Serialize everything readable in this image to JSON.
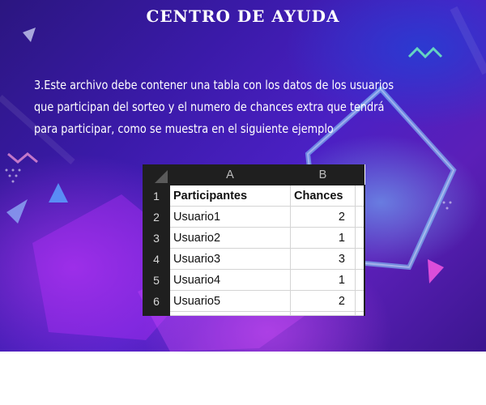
{
  "header": {
    "title": "CENTRO DE AYUDA"
  },
  "instructions": {
    "lines": [
      "3.Este archivo debe contener una tabla con los datos de los usuarios",
      " que participan del sorteo y el numero de chances extra que tendrá",
      "para participar, como se muestra en el siguiente ejemplo"
    ]
  },
  "spreadsheet": {
    "columns": [
      "A",
      "B"
    ],
    "rows": [
      {
        "num": "1",
        "a": "Participantes",
        "b": "Chances"
      },
      {
        "num": "2",
        "a": "Usuario1",
        "b": "2"
      },
      {
        "num": "3",
        "a": "Usuario2",
        "b": "1"
      },
      {
        "num": "4",
        "a": "Usuario3",
        "b": "3"
      },
      {
        "num": "5",
        "a": "Usuario4",
        "b": "1"
      },
      {
        "num": "6",
        "a": "Usuario5",
        "b": "2"
      }
    ]
  },
  "colors": {
    "background_top": "#2b1680",
    "background_mid": "#4b20c4",
    "accent_magenta": "#c83cff",
    "accent_cyan": "#78c8ff",
    "sheet_header": "#1f1f1f"
  }
}
